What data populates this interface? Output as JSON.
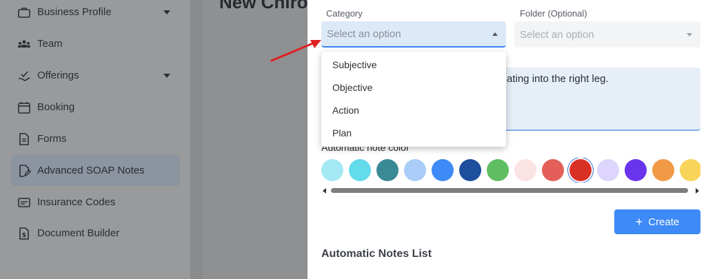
{
  "background": {
    "page_title": "New Chiro",
    "sidebar": {
      "items": [
        {
          "label": "Business Profile",
          "icon": "briefcase-icon",
          "has_caret": true
        },
        {
          "label": "Team",
          "icon": "team-icon",
          "has_caret": false
        },
        {
          "label": "Offerings",
          "icon": "offerings-icon",
          "has_caret": true
        },
        {
          "label": "Booking",
          "icon": "calendar-icon",
          "has_caret": false
        },
        {
          "label": "Forms",
          "icon": "document-icon",
          "has_caret": false
        },
        {
          "label": "Advanced SOAP Notes",
          "icon": "edit-document-icon",
          "has_caret": false,
          "active": true
        },
        {
          "label": "Insurance Codes",
          "icon": "card-icon",
          "has_caret": false
        },
        {
          "label": "Document Builder",
          "icon": "dollar-document-icon",
          "has_caret": false
        }
      ]
    }
  },
  "modal": {
    "category": {
      "label": "Category",
      "placeholder": "Select an option",
      "open": true
    },
    "folder": {
      "label": "Folder (Optional)",
      "placeholder": "Select an option"
    },
    "category_options": [
      "Subjective",
      "Objective",
      "Action",
      "Plan"
    ],
    "note_text_visible": "ating into the right leg.",
    "color_label": "Automatic note color",
    "colors": [
      "#a4e8f3",
      "#63dbeb",
      "#3a8a96",
      "#a9cdf8",
      "#3e8af6",
      "#1d4f9c",
      "#5fbd62",
      "#fbe3e3",
      "#e45f5a",
      "#d93025",
      "#ddd5fb",
      "#6a34ec",
      "#f09a45",
      "#f9d45a"
    ],
    "selected_color": "#d93025",
    "create_button": {
      "icon": "plus-icon",
      "label": "Create"
    },
    "list_title": "Automatic Notes List"
  },
  "annotation": {
    "arrow_color": "#e02020"
  }
}
